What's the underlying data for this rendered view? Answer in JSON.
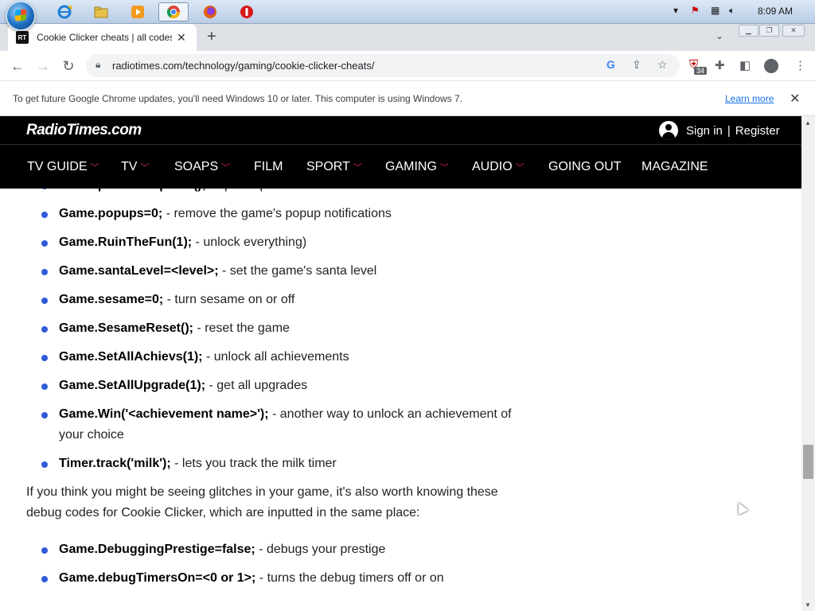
{
  "taskbar": {
    "clock": "8:09 AM",
    "apps": [
      "ie-icon",
      "explorer-icon",
      "media-player-icon",
      "chrome-icon",
      "firefox-icon",
      "opera-icon"
    ]
  },
  "tab": {
    "favicon": "RT",
    "title": "Cookie Clicker cheats | all codes",
    "close": "✕"
  },
  "toolbar": {
    "url": "radiotimes.com/technology/gaming/cookie-clicker-cheats/",
    "ext_badge": "34"
  },
  "infobar": {
    "message": "To get future Google Chrome updates, you'll need Windows 10 or later. This computer is using Windows 7.",
    "learn_more": "Learn more"
  },
  "site": {
    "logo": "RadioTimes.com",
    "signin": "Sign in",
    "separator": "|",
    "register": "Register",
    "nav": [
      "TV GUIDE",
      "TV",
      "SOAPS",
      "FILM",
      "SPORT",
      "GAMING",
      "AUDIO",
      "GOING OUT",
      "MAGAZINE"
    ]
  },
  "article": {
    "list1": [
      {
        "code": "Game.particlesUpdate();",
        "desc": " - update particles"
      },
      {
        "code": "Game.popups=0;",
        "desc": " - remove the game's popup notifications"
      },
      {
        "code": "Game.RuinTheFun(1);",
        "desc": " - unlock everything)"
      },
      {
        "code": "Game.santaLevel=<level>;",
        "desc": " - set the game's santa level"
      },
      {
        "code": "Game.sesame=0;",
        "desc": " - turn sesame on or off"
      },
      {
        "code": "Game.SesameReset();",
        "desc": " - reset the game"
      },
      {
        "code": "Game.SetAllAchievs(1);",
        "desc": " - unlock all achievements"
      },
      {
        "code": "Game.SetAllUpgrade(1);",
        "desc": " - get all upgrades"
      },
      {
        "code": "Game.Win('<achievement name>');",
        "desc": " - another way to unlock an achievement of your choice"
      },
      {
        "code": "Timer.track('milk');",
        "desc": " - lets you track the milk timer"
      }
    ],
    "paragraph": "If you think you might be seeing glitches in your game, it's also worth knowing these debug codes for Cookie Clicker, which are inputted in the same place:",
    "list2": [
      {
        "code": "Game.DebuggingPrestige=false;",
        "desc": " - debugs your prestige"
      },
      {
        "code": "Game.debugTimersOn=<0 or 1>;",
        "desc": " - turns the debug timers off or on"
      }
    ]
  }
}
